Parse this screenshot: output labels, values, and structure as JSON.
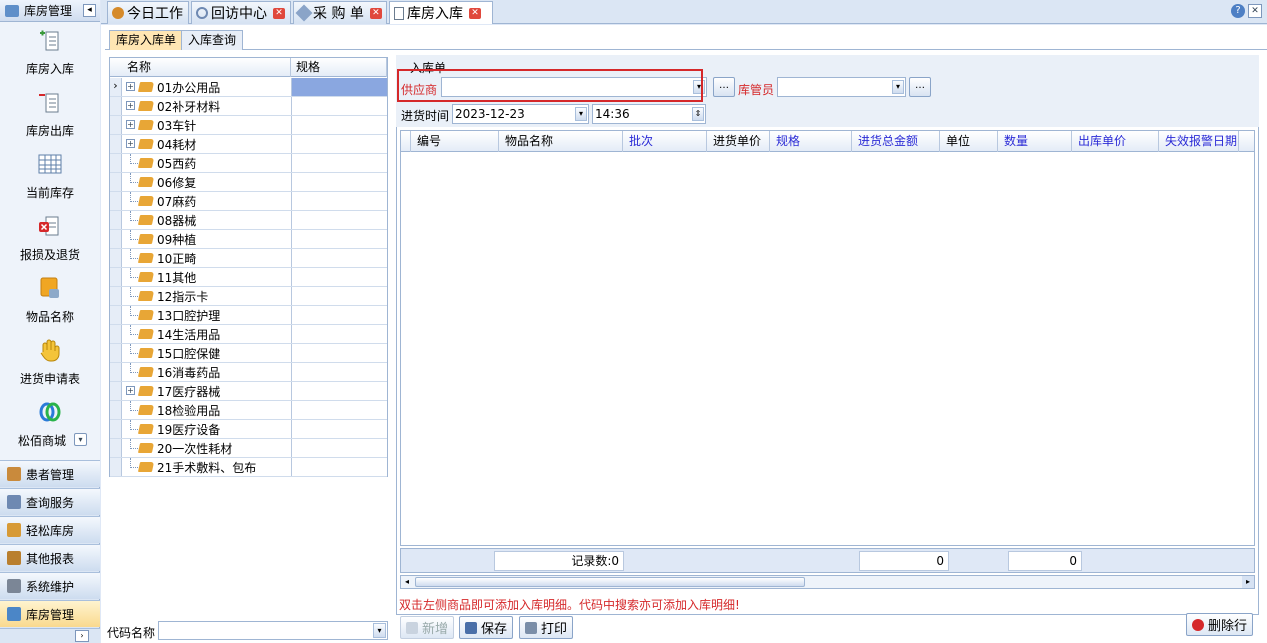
{
  "nav": {
    "title": "库房管理",
    "items": [
      {
        "label": "库房入库",
        "icon": "stock-in-icon"
      },
      {
        "label": "库房出库",
        "icon": "stock-out-icon"
      },
      {
        "label": "当前库存",
        "icon": "inventory-grid-icon"
      },
      {
        "label": "报损及退货",
        "icon": "loss-return-icon"
      },
      {
        "label": "物品名称",
        "icon": "item-name-icon"
      },
      {
        "label": "进货申请表",
        "icon": "hand-icon"
      },
      {
        "label": "松佰商城",
        "icon": "mall-logo-icon"
      }
    ],
    "groups": [
      {
        "label": "患者管理",
        "color": "#c98a3c"
      },
      {
        "label": "查询服务",
        "color": "#6e89b2"
      },
      {
        "label": "轻松库房",
        "color": "#d79a36"
      },
      {
        "label": "其他报表",
        "color": "#b97f2e"
      },
      {
        "label": "系统维护",
        "color": "#7b8696"
      },
      {
        "label": "库房管理",
        "color": "#4b86c7"
      }
    ]
  },
  "tabs": [
    {
      "label": "今日工作"
    },
    {
      "label": "回访中心"
    },
    {
      "label": "采 购 单"
    },
    {
      "label": "库房入库"
    }
  ],
  "subtabs": [
    {
      "label": "库房入库单"
    },
    {
      "label": "入库查询"
    }
  ],
  "tree": {
    "headers": [
      "名称",
      "规格"
    ],
    "rows": [
      {
        "name": "01办公用品",
        "expand": "+"
      },
      {
        "name": "02补牙材料",
        "expand": "+"
      },
      {
        "name": "03车针",
        "expand": "+"
      },
      {
        "name": "04耗材",
        "expand": "+"
      },
      {
        "name": "05西药",
        "expand": ""
      },
      {
        "name": "06修复",
        "expand": ""
      },
      {
        "name": "07麻药",
        "expand": ""
      },
      {
        "name": "08器械",
        "expand": ""
      },
      {
        "name": "09种植",
        "expand": ""
      },
      {
        "name": "10正畸",
        "expand": ""
      },
      {
        "name": "11其他",
        "expand": ""
      },
      {
        "name": "12指示卡",
        "expand": ""
      },
      {
        "name": "13口腔护理",
        "expand": ""
      },
      {
        "name": "14生活用品",
        "expand": ""
      },
      {
        "name": "15口腔保健",
        "expand": ""
      },
      {
        "name": "16消毒药品",
        "expand": ""
      },
      {
        "name": "17医疗器械",
        "expand": "+"
      },
      {
        "name": "18检验用品",
        "expand": ""
      },
      {
        "name": "19医疗设备",
        "expand": ""
      },
      {
        "name": "20一次性耗材",
        "expand": ""
      },
      {
        "name": "21手术敷料、包布",
        "expand": ""
      }
    ],
    "code_label": "代码名称",
    "code_value": ""
  },
  "form": {
    "section_title": "入库单",
    "supplier_label": "供应商",
    "supplier_value": "",
    "keeper_label": "库管员",
    "keeper_value": "",
    "date_label": "进货时间",
    "date_value": "2023-12-23",
    "time_value": "14:36"
  },
  "grid": {
    "columns": [
      {
        "label": "编号",
        "color": "#000"
      },
      {
        "label": "物品名称",
        "color": "#000"
      },
      {
        "label": "批次",
        "color": "#2b2bd6"
      },
      {
        "label": "进货单价",
        "color": "#000"
      },
      {
        "label": "规格",
        "color": "#2b2bd6"
      },
      {
        "label": "进货总金额",
        "color": "#2b2bd6"
      },
      {
        "label": "单位",
        "color": "#000"
      },
      {
        "label": "数量",
        "color": "#2b2bd6"
      },
      {
        "label": "出库单价",
        "color": "#2b2bd6"
      },
      {
        "label": "失效报警日期",
        "color": "#2b2bd6"
      }
    ],
    "footer": {
      "count": "记录数:0",
      "total_amount": "0",
      "total_qty": "0"
    }
  },
  "hint": "双击左侧商品即可添加入库明细。代码中搜索亦可添加入库明细!",
  "buttons": {
    "add": "新增",
    "save": "保存",
    "print": "打印",
    "delete_row": "删除行"
  }
}
